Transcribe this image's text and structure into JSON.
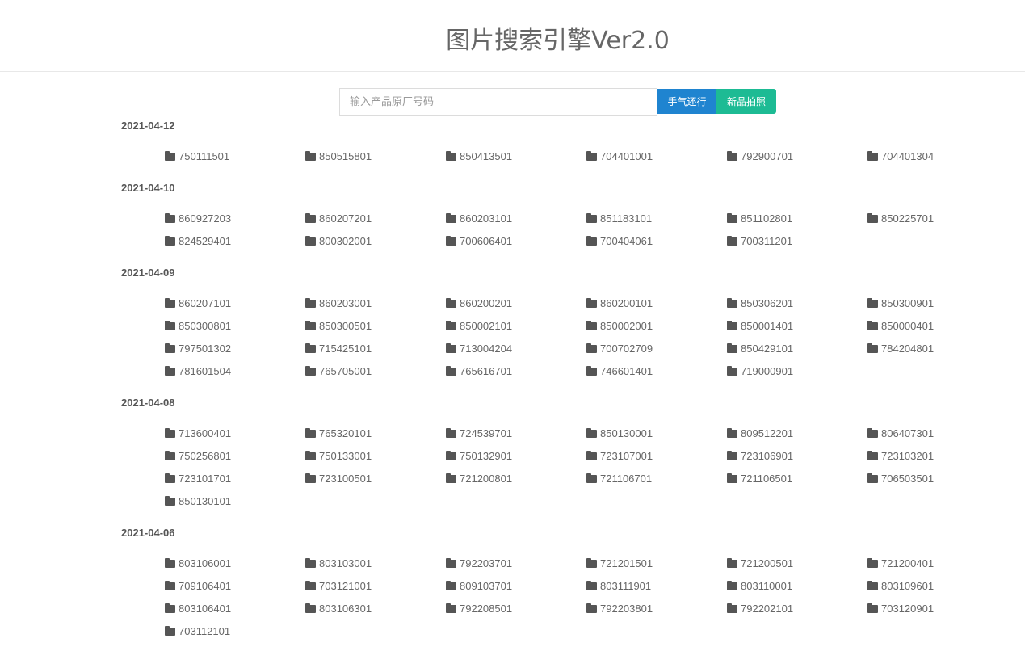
{
  "header": {
    "title": "图片搜索引擎Ver2.0"
  },
  "search": {
    "placeholder": "输入产品原厂号码",
    "value": "",
    "button_luck": "手气还行",
    "button_new": "新品拍照"
  },
  "groups": [
    {
      "date": "2021-04-12",
      "items": [
        "750111501",
        "850515801",
        "850413501",
        "704401001",
        "792900701",
        "704401304"
      ]
    },
    {
      "date": "2021-04-10",
      "items": [
        "860927203",
        "860207201",
        "860203101",
        "851183101",
        "851102801",
        "850225701",
        "824529401",
        "800302001",
        "700606401",
        "700404061",
        "700311201"
      ]
    },
    {
      "date": "2021-04-09",
      "items": [
        "860207101",
        "860203001",
        "860200201",
        "860200101",
        "850306201",
        "850300901",
        "850300801",
        "850300501",
        "850002101",
        "850002001",
        "850001401",
        "850000401",
        "797501302",
        "715425101",
        "713004204",
        "700702709",
        "850429101",
        "784204801",
        "781601504",
        "765705001",
        "765616701",
        "746601401",
        "719000901"
      ]
    },
    {
      "date": "2021-04-08",
      "items": [
        "713600401",
        "765320101",
        "724539701",
        "850130001",
        "809512201",
        "806407301",
        "750256801",
        "750133001",
        "750132901",
        "723107001",
        "723106901",
        "723103201",
        "723101701",
        "723100501",
        "721200801",
        "721106701",
        "721106501",
        "706503501",
        "850130101"
      ]
    },
    {
      "date": "2021-04-06",
      "items": [
        "803106001",
        "803103001",
        "792203701",
        "721201501",
        "721200501",
        "721200401",
        "709106401",
        "703121001",
        "809103701",
        "803111901",
        "803110001",
        "803109601",
        "803106401",
        "803106301",
        "792208501",
        "792203801",
        "792202101",
        "703120901",
        "703112101"
      ]
    }
  ]
}
